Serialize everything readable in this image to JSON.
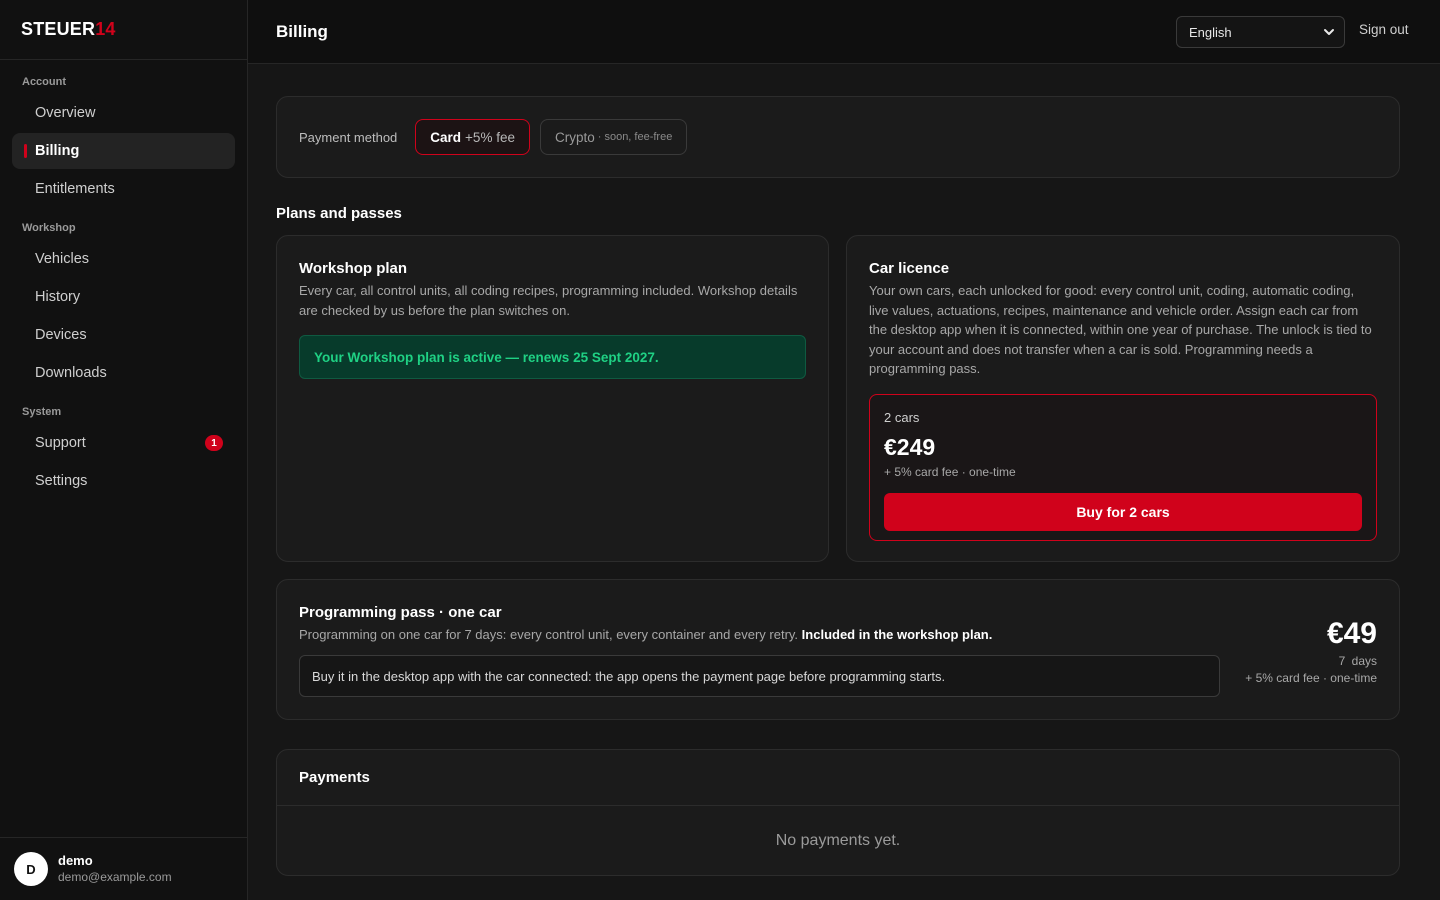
{
  "brand": {
    "name_main": "STEUER",
    "name_accent": "14",
    "accent_color": "#d0021b"
  },
  "sidebar": {
    "sections": [
      {
        "label": "Account",
        "items": [
          {
            "label": "Overview",
            "active": false
          },
          {
            "label": "Billing",
            "active": true
          },
          {
            "label": "Entitlements",
            "active": false
          }
        ]
      },
      {
        "label": "Workshop",
        "items": [
          {
            "label": "Vehicles",
            "active": false
          },
          {
            "label": "History",
            "active": false
          },
          {
            "label": "Devices",
            "active": false
          },
          {
            "label": "Downloads",
            "active": false
          }
        ]
      },
      {
        "label": "System",
        "items": [
          {
            "label": "Support",
            "active": false,
            "badge": "1"
          },
          {
            "label": "Settings",
            "active": false
          }
        ]
      }
    ],
    "user": {
      "initial": "D",
      "name": "demo",
      "email": "demo@example.com"
    }
  },
  "header": {
    "title": "Billing",
    "language": "English",
    "sign_out": "Sign out"
  },
  "payment_method": {
    "label": "Payment method",
    "card": {
      "name": "Card",
      "fee": "+5% fee"
    },
    "crypto": {
      "name": "Crypto",
      "note": "· soon, fee-free"
    }
  },
  "plans": {
    "section_title": "Plans and passes",
    "workshop": {
      "title": "Workshop plan",
      "description": "Every car, all control units, all coding recipes, programming included. Workshop details are checked by us before the plan switches on.",
      "status": "Your Workshop plan is active — renews 25 Sept 2027."
    },
    "licence": {
      "title": "Car licence",
      "description": "Your own cars, each unlocked for good: every control unit, coding, automatic coding, live values, actuations, recipes, maintenance and vehicle order. Assign each car from the desktop app when it is connected, within one year of purchase. The unlock is tied to your account and does not transfer when a car is sold. Programming needs a programming pass.",
      "count": "2 cars",
      "price": "€249",
      "note": "+ 5% card fee · one-time",
      "button": "Buy for 2 cars"
    }
  },
  "pass": {
    "title": "Programming pass · one car",
    "description": "Programming on one car for 7 days: every control unit, every container and every retry.",
    "highlight": "Included in the workshop plan.",
    "info": "Buy it in the desktop app with the car connected: the app opens the payment page before programming starts.",
    "price": "€49",
    "days": "7 days",
    "fee": "+ 5% card fee · one-time"
  },
  "payments": {
    "title": "Payments",
    "empty": "No payments yet."
  }
}
